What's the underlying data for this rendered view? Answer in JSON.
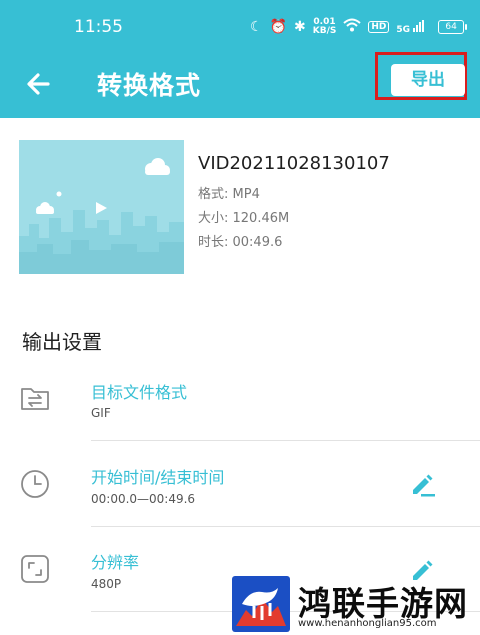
{
  "status_bar": {
    "time": "11:55",
    "speed_value": "0.01",
    "speed_unit": "KB/S",
    "hd": "HD",
    "network": "5G",
    "battery": "64"
  },
  "toolbar": {
    "title": "转换格式",
    "export_label": "导出"
  },
  "video": {
    "name": "VID20211028130107",
    "format": "格式: MP4",
    "size": "大小: 120.46M",
    "duration": "时长: 00:49.6"
  },
  "output_settings": {
    "title": "输出设置",
    "items": [
      {
        "label": "目标文件格式",
        "value": "GIF",
        "icon": "folder-swap-icon"
      },
      {
        "label": "开始时间/结束时间",
        "value": "00:00.0—00:49.6",
        "icon": "clock-icon"
      },
      {
        "label": "分辨率",
        "value": "480P",
        "icon": "expand-icon"
      }
    ]
  },
  "watermark": {
    "title": "鸿联手游网",
    "url": "www.henanhonglian95.com"
  },
  "colors": {
    "accent": "#37bfd4",
    "highlight_box": "#d81e1e",
    "thumbnail": "#9fdde7"
  }
}
